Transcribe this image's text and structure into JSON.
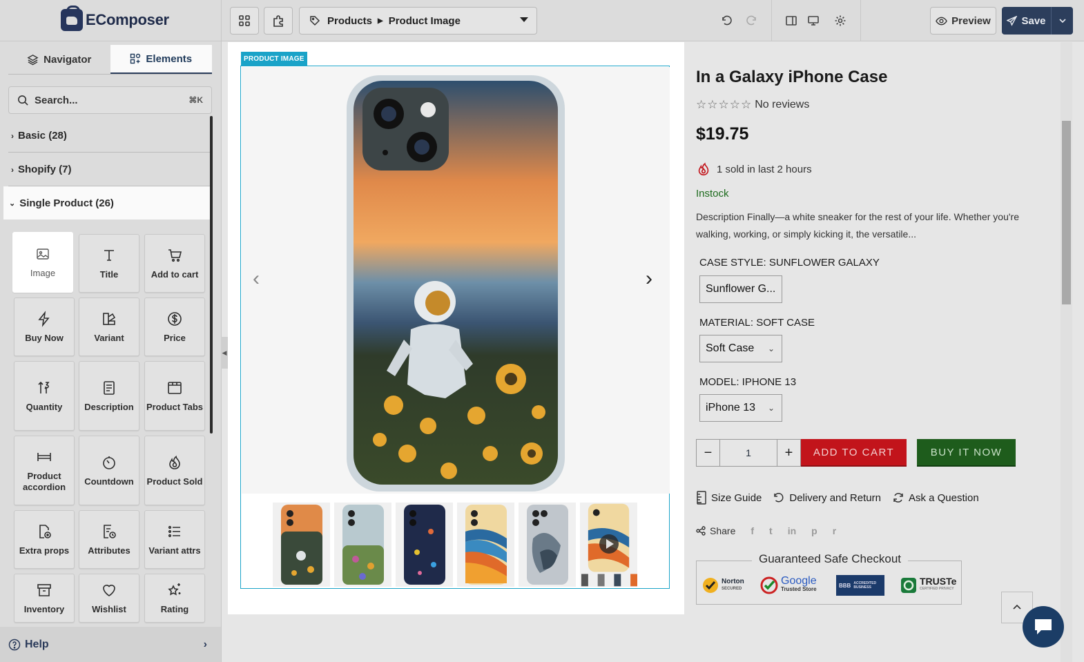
{
  "app": {
    "name": "EComposer"
  },
  "toolbar": {
    "breadcrumb": [
      "Products",
      "Product Image"
    ],
    "preview_label": "Preview",
    "save_label": "Save"
  },
  "sidebar": {
    "tabs": [
      {
        "label": "Navigator",
        "active": false
      },
      {
        "label": "Elements",
        "active": true
      }
    ],
    "search": {
      "placeholder": "Search...",
      "shortcut": "⌘K"
    },
    "categories": [
      {
        "label": "Basic (28)",
        "open": false
      },
      {
        "label": "Shopify (7)",
        "open": false
      },
      {
        "label": "Single Product (26)",
        "open": true
      }
    ],
    "elements": [
      {
        "label": "Image",
        "icon": "image-icon",
        "selected": true
      },
      {
        "label": "Title",
        "icon": "title-icon"
      },
      {
        "label": "Add to cart",
        "icon": "cart-icon"
      },
      {
        "label": "Buy Now",
        "icon": "lightning-icon"
      },
      {
        "label": "Variant",
        "icon": "variant-icon"
      },
      {
        "label": "Price",
        "icon": "price-icon"
      },
      {
        "label": "Quantity",
        "icon": "quantity-icon"
      },
      {
        "label": "Description",
        "icon": "description-icon"
      },
      {
        "label": "Product Tabs",
        "icon": "tabs-icon"
      },
      {
        "label": "Product accordion",
        "icon": "accordion-icon"
      },
      {
        "label": "Countdown",
        "icon": "countdown-icon"
      },
      {
        "label": "Product Sold",
        "icon": "fire-icon"
      },
      {
        "label": "Extra props",
        "icon": "extra-props-icon"
      },
      {
        "label": "Attributes",
        "icon": "attributes-icon"
      },
      {
        "label": "Variant attrs",
        "icon": "list-icon"
      },
      {
        "label": "Inventory",
        "icon": "inventory-icon"
      },
      {
        "label": "Wishlist",
        "icon": "heart-icon"
      },
      {
        "label": "Rating",
        "icon": "rating-icon"
      }
    ],
    "help_label": "Help"
  },
  "canvas": {
    "element_label": "PRODUCT IMAGE",
    "thumbnail_count": 6
  },
  "product": {
    "title": "In a Galaxy iPhone Case",
    "stars": "☆☆☆☆☆",
    "reviews": "No reviews",
    "price": "$19.75",
    "sold_text": "1 sold in last 2 hours",
    "stock": "Instock",
    "description": "Description Finally—a white sneaker for the rest of your life. Whether you're walking, working, or simply kicking it, the versatile...",
    "options": [
      {
        "label": "CASE STYLE: SUNFLOWER GALAXY",
        "value": "Sunflower G..."
      },
      {
        "label": "MATERIAL: SOFT CASE",
        "value": "Soft Case"
      },
      {
        "label": "MODEL: IPHONE 13",
        "value": "iPhone 13"
      }
    ],
    "quantity": "1",
    "minus": "−",
    "plus": "+",
    "add_to_cart": "ADD TO CART",
    "buy_now": "BUY IT NOW",
    "links": [
      "Size Guide",
      "Delivery and Return",
      "Ask a Question"
    ],
    "share_label": "Share",
    "social": [
      "f",
      "t",
      "in",
      "p",
      "r"
    ],
    "guarantee_title": "Guaranteed Safe Checkout",
    "badges": [
      "Norton",
      "Google",
      "BBB",
      "TRUSTe"
    ],
    "badge_sub": [
      "SECURED",
      "Trusted Store",
      "ACCREDITED BUSINESS",
      "CERTIFIED PRIVACY"
    ]
  },
  "colors": {
    "accent": "#1aa3c8",
    "navy": "#2c3e5c",
    "add_to_cart": "#c2141b",
    "buy_now": "#1e5c1c",
    "in_stock": "#1d6b1d"
  }
}
